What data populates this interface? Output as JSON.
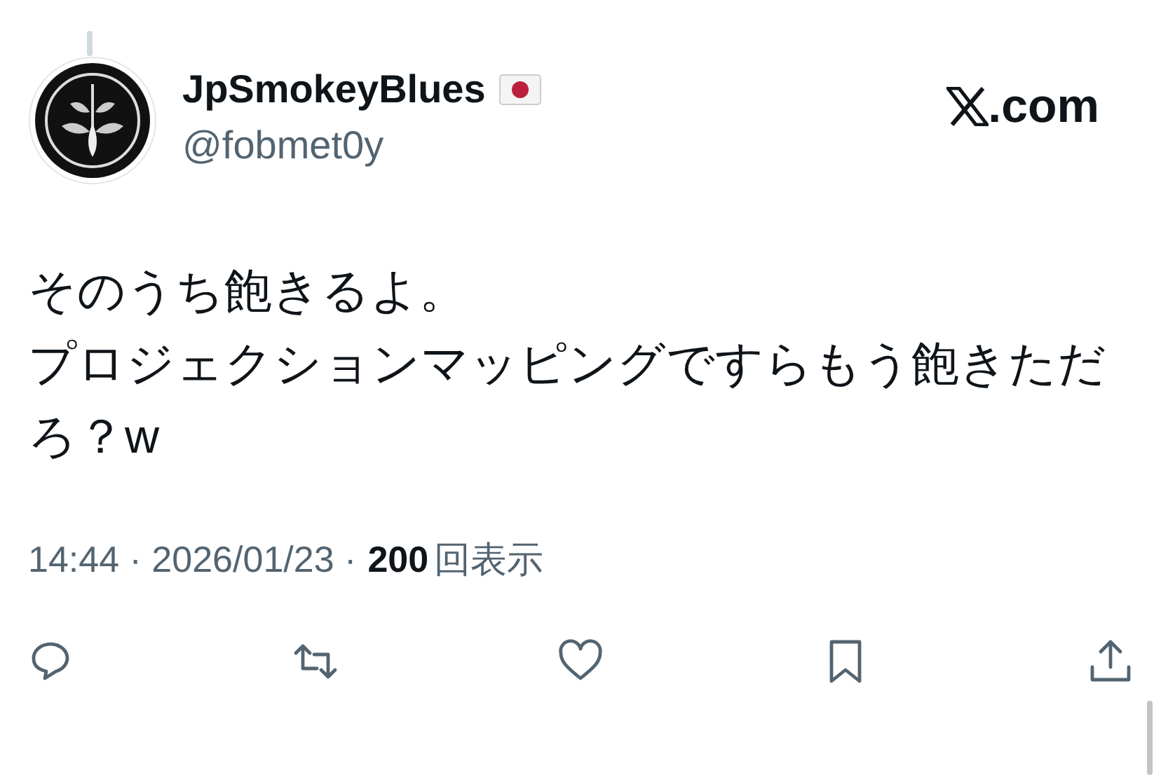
{
  "author": {
    "name": "JpSmokeyBlues",
    "handle": "@fobmet0y"
  },
  "brand": {
    "text": ".com"
  },
  "body": [
    "そのうち飽きるよ。",
    "プロジェクションマッピングですらもう飽きただろ？w"
  ],
  "meta": {
    "timestamp": "14:44 · 2026/01/23 ·",
    "views": "200",
    "views_label": "回表示"
  },
  "actions": [
    {
      "kind": "reply"
    },
    {
      "kind": "repost"
    },
    {
      "kind": "like"
    },
    {
      "kind": "bookmark"
    },
    {
      "kind": "share"
    }
  ]
}
